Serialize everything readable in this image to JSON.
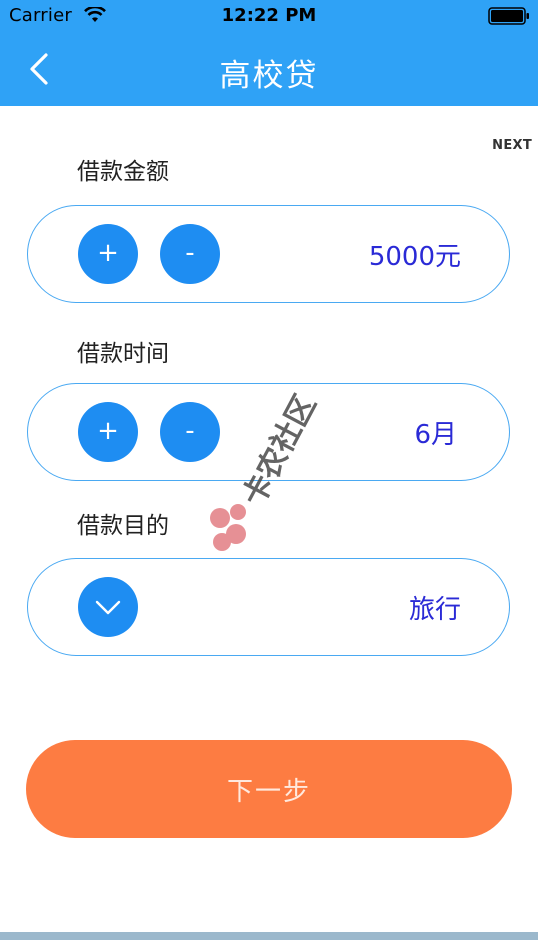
{
  "status_bar": {
    "carrier": "Carrier",
    "time": "12:22 PM",
    "wifi_icon": "wifi-icon",
    "battery_icon": "battery-icon"
  },
  "nav": {
    "title": "高校贷",
    "back_icon": "chevron-left-icon",
    "background_color": "#2fa2f6"
  },
  "next_label": "NEXT",
  "loan_amount": {
    "label": "借款金额",
    "plus": "+",
    "minus": "-",
    "value": "5000元"
  },
  "loan_term": {
    "label": "借款时间",
    "plus": "+",
    "minus": "-",
    "value": "6月"
  },
  "loan_purpose": {
    "label": "借款目的",
    "dropdown_icon": "chevron-down-icon",
    "value": "旅行"
  },
  "submit": {
    "label": "下一步",
    "color": "#fd7c42"
  },
  "watermark": {
    "text": "卡农社区"
  },
  "colors": {
    "accent": "#1e8df2",
    "value_text": "#2a2ad6"
  }
}
